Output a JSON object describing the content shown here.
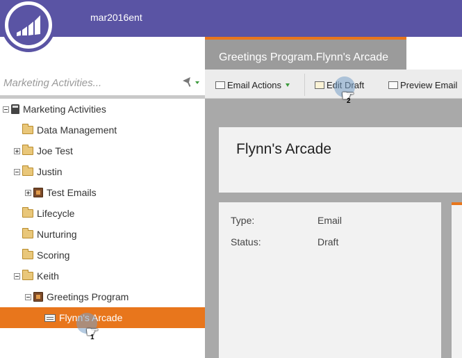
{
  "header": {
    "workspace": "mar2016ent"
  },
  "search": {
    "placeholder": "Marketing Activities..."
  },
  "tree": {
    "root": "Marketing Activities",
    "items": [
      {
        "label": "Data Management"
      },
      {
        "label": "Joe Test"
      },
      {
        "label": "Justin"
      },
      {
        "label": "Test Emails"
      },
      {
        "label": "Lifecycle"
      },
      {
        "label": "Nurturing"
      },
      {
        "label": "Scoring"
      },
      {
        "label": "Keith"
      },
      {
        "label": "Greetings Program"
      },
      {
        "label": "Flynn's Arcade"
      }
    ],
    "selected": "Flynn's Arcade"
  },
  "tab": {
    "title": "Greetings Program.Flynn's Arcade"
  },
  "toolbar": {
    "email_actions": "Email Actions",
    "edit_draft": "Edit Draft",
    "preview_email": "Preview Email"
  },
  "asset": {
    "name": "Flynn's Arcade",
    "type_label": "Type:",
    "type_value": "Email",
    "status_label": "Status:",
    "status_value": "Draft"
  },
  "steps": {
    "first": "1",
    "second": "2"
  },
  "colors": {
    "brand": "#5a54a4",
    "accent": "#e8761c"
  },
  "icons": [
    "marketo-logo-icon",
    "filter-icon",
    "folder-icon",
    "program-icon",
    "email-icon",
    "hand-cursor-icon"
  ]
}
